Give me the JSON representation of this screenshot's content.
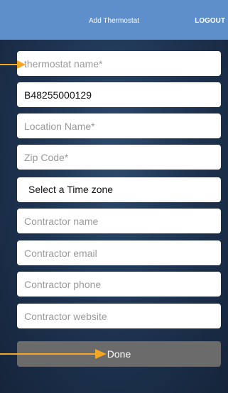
{
  "header": {
    "title": "Add Thermostat",
    "logout_label": "LOGOUT",
    "background": "#5f8fcb"
  },
  "form": {
    "thermostat_name": {
      "placeholder": "thermostat name*",
      "value": ""
    },
    "serial_number": {
      "value": "B48255000129"
    },
    "location_name": {
      "placeholder": "Location Name*",
      "value": ""
    },
    "zip_code": {
      "placeholder": "Zip Code*",
      "value": ""
    },
    "time_zone": {
      "label": "Select a Time zone"
    },
    "contractor_name": {
      "placeholder": "Contractor name",
      "value": ""
    },
    "contractor_email": {
      "placeholder": "Contractor email",
      "value": ""
    },
    "contractor_phone": {
      "placeholder": "Contractor phone",
      "value": ""
    },
    "contractor_website": {
      "placeholder": "Contractor website",
      "value": ""
    },
    "done_label": "Done"
  },
  "annotations": {
    "arrow_color": "#f5a623",
    "arrow_icon": "orange-arrow-icon"
  }
}
